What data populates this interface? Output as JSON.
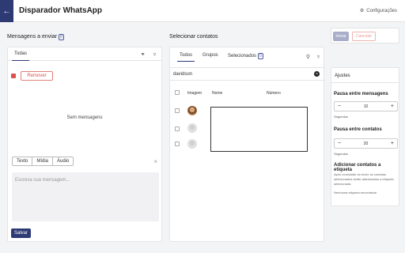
{
  "header": {
    "title": "Disparador WhatsApp",
    "back_icon": "arrow-left-icon",
    "settings_label": "Configurações",
    "settings_icon": "gear-icon"
  },
  "messages": {
    "section_title": "Mensagens a enviar",
    "count": "0",
    "tab": "Todas",
    "remove_label": "Remover",
    "empty_label": "Sem mensagens",
    "types": [
      "Texto",
      "Mídia",
      "Áudio"
    ],
    "placeholder": "Escreva sua mensagem...",
    "save_label": "Salvar"
  },
  "contacts": {
    "section_title": "Selecionar contatos",
    "tabs": [
      "Todos",
      "Grupos",
      "Selecionados"
    ],
    "selected_count": "0",
    "filter_value": "davidson",
    "columns": [
      "Imagem",
      "Nome",
      "Número"
    ]
  },
  "actions": {
    "start_label": "Iniciar",
    "cancel_label": "Cancelar"
  },
  "settings": {
    "title": "Ajustes",
    "msg_interval_label": "Pausa entre mensagens",
    "msg_interval_value": "10",
    "contact_interval_label": "Pausa entre contatos",
    "contact_interval_value": "20",
    "unit": "Segundos",
    "tag_label": "Adicionar contatos a etiqueta",
    "tag_description": "Após conclusão do envio os contatos selecionados serão adicionados a etiqueta selecionada.",
    "no_tag": "Nenhuma etiqueta encontrada"
  },
  "colors": {
    "primary": "#2d3a74",
    "danger": "#d9534f"
  }
}
